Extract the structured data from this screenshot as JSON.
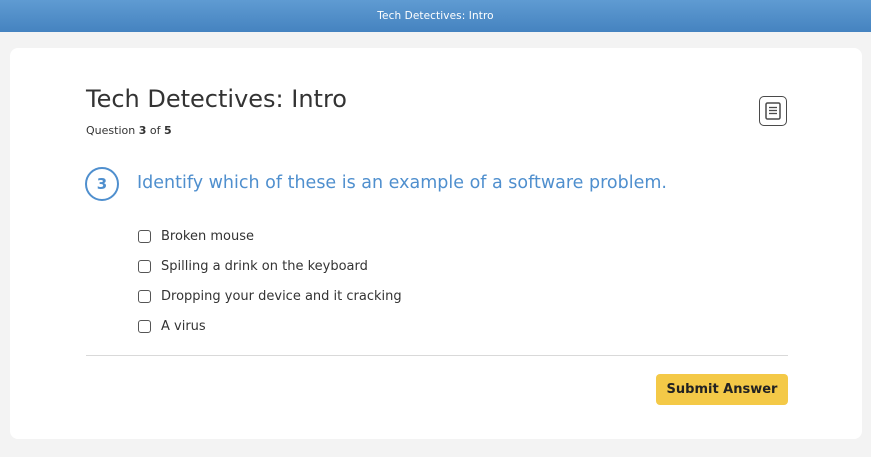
{
  "topbar": {
    "title": "Tech Detectives: Intro"
  },
  "quiz": {
    "title": "Tech Detectives: Intro",
    "progress": {
      "prefix": "Question",
      "current": "3",
      "separator": "of",
      "total": "5"
    },
    "notes_icon": "notes-icon"
  },
  "question": {
    "number": "3",
    "text": "Identify which of these is an example of a software problem.",
    "options": [
      {
        "label": "Broken mouse",
        "checked": false
      },
      {
        "label": "Spilling a drink on the keyboard",
        "checked": false
      },
      {
        "label": "Dropping your device and it cracking",
        "checked": false
      },
      {
        "label": "A virus",
        "checked": false
      }
    ]
  },
  "actions": {
    "submit_label": "Submit Answer"
  },
  "colors": {
    "header": "#4f8fce",
    "accent": "#4f8fce",
    "submit": "#f4c947",
    "background": "#f3f3f3"
  }
}
